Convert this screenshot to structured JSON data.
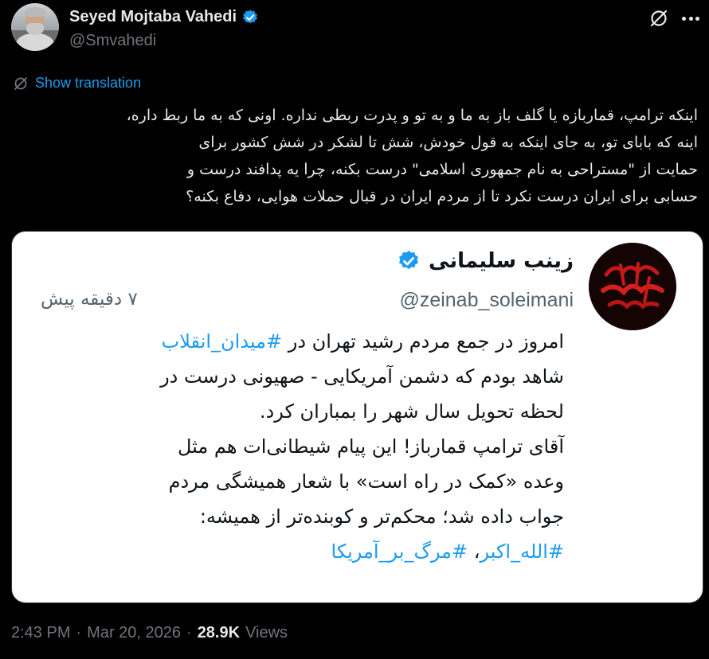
{
  "author": {
    "name": "Seyed Mojtaba Vahedi",
    "handle": "@Smvahedi"
  },
  "show_translation_label": "Show translation",
  "tweet": {
    "lines": [
      "اینکه ترامپ، قماربازه یا گلف باز به ما و به تو و پدرت ربطی نداره. اونی که به ما ربط داره،",
      "اینه که بابای تو، به جای اینکه به قول خودش، شش تا لشکر در شش کشور برای",
      "حمایت از \"مستراحی به نام جمهوری اسلامی\" درست بکنه، چرا یه پدافند درست و",
      "حسابی برای ایران درست نکرد تا از مردم ایران در قبال حملات هوایی، دفاع بکنه؟"
    ]
  },
  "quoted": {
    "name": "زینب سلیمانی",
    "handle": "@zeinab_soleimani",
    "time": "۷ دقیقه پیش",
    "line1_prefix": "امروز در جمع مردم رشید تهران در ",
    "line1_hashtag": "#میدان_انقلاب",
    "lines": [
      "شاهد بودم که دشمن آمریکایی - صهیونی درست در",
      "لحظه تحویل سال شهر را بمباران کرد.",
      "آقای ترامپ قمارباز! این پیام شیطانی‌ات هم مثل",
      "وعده «کمک در راه است» با شعار همیشگی مردم",
      "جواب داده شد؛ محکم‌تر و کوبنده‌تر از همیشه:"
    ],
    "hashtag_a": "#الله_اکبر",
    "separator": "، ",
    "hashtag_b": "#مرگ_بر_آمریکا"
  },
  "meta": {
    "time": "2:43 PM",
    "dot1": "·",
    "date": "Mar 20, 2026",
    "dot2": "·",
    "views_count": "28.9K",
    "views_label": "Views"
  },
  "colors": {
    "background": "#000000",
    "link_blue": "#1d9bf0",
    "muted_gray": "#71767b",
    "card_bg": "#ffffff"
  },
  "icons": [
    "verified-badge-icon",
    "grok-icon",
    "more-icon",
    "translate-icon"
  ]
}
